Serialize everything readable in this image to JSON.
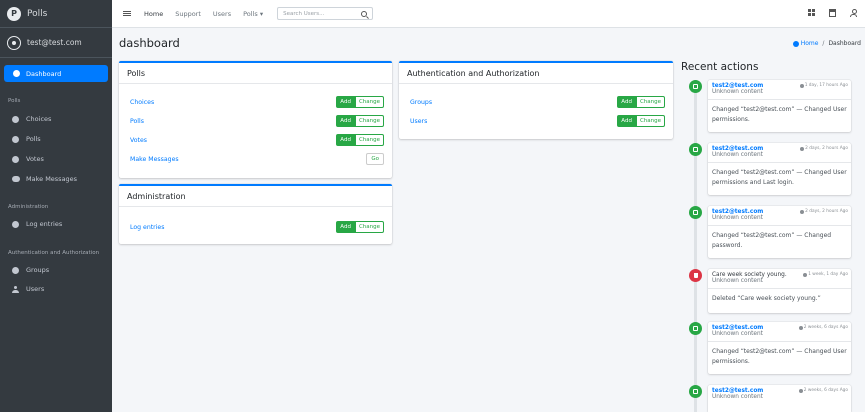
{
  "brand": {
    "title": "Polls"
  },
  "user": {
    "name": "test@test.com"
  },
  "sidebar": {
    "active": "Dashboard",
    "sections": [
      {
        "header": "Polls",
        "items": [
          "Choices",
          "Polls",
          "Votes",
          "Make Messages"
        ]
      },
      {
        "header": "Administration",
        "items": [
          "Log entries"
        ]
      },
      {
        "header": "Authentication and Authorization",
        "items": [
          "Groups",
          "Users"
        ]
      }
    ]
  },
  "topnav": {
    "links": [
      "Home",
      "Support",
      "Users",
      "Polls ▾"
    ],
    "search_placeholder": "Search Users..."
  },
  "page": {
    "title": "dashboard"
  },
  "breadcrumb": {
    "home": "Home",
    "separator": "/",
    "current": "Dashboard"
  },
  "buttons": {
    "add": "Add",
    "change": "Change",
    "go": "Go"
  },
  "apps": {
    "polls": {
      "title": "Polls",
      "models": [
        "Choices",
        "Polls",
        "Votes",
        "Make Messages"
      ]
    },
    "administration": {
      "title": "Administration",
      "models": [
        "Log entries"
      ]
    },
    "auth": {
      "title": "Authentication and Authorization",
      "models": [
        "Groups",
        "Users"
      ]
    }
  },
  "recent_actions": {
    "title": "Recent actions",
    "items": [
      {
        "who": "test2@test.com",
        "content_type": "Unknown content",
        "time": "1 day, 17 hours Ago",
        "message": "Changed “test2@test.com” — Changed User permissions.",
        "kind": "change"
      },
      {
        "who": "test2@test.com",
        "content_type": "Unknown content",
        "time": "2 days, 2 hours Ago",
        "message": "Changed “test2@test.com” — Changed User permissions and Last login.",
        "kind": "change"
      },
      {
        "who": "test2@test.com",
        "content_type": "Unknown content",
        "time": "2 days, 2 hours Ago",
        "message": "Changed “test2@test.com” — Changed password.",
        "kind": "change"
      },
      {
        "who": "Care week society young.",
        "content_type": "Unknown content",
        "time": "1 week, 1 day Ago",
        "message": "Deleted “Care week society young.”",
        "kind": "delete"
      },
      {
        "who": "test2@test.com",
        "content_type": "Unknown content",
        "time": "2 weeks, 6 days Ago",
        "message": "Changed “test2@test.com” — Changed User permissions.",
        "kind": "change"
      },
      {
        "who": "test2@test.com",
        "content_type": "Unknown content",
        "time": "2 weeks, 6 days Ago",
        "message": "",
        "kind": "change"
      }
    ]
  },
  "colors": {
    "sidebar": "#343a40",
    "primary": "#007bff",
    "success": "#28a745",
    "danger": "#dc3545"
  }
}
